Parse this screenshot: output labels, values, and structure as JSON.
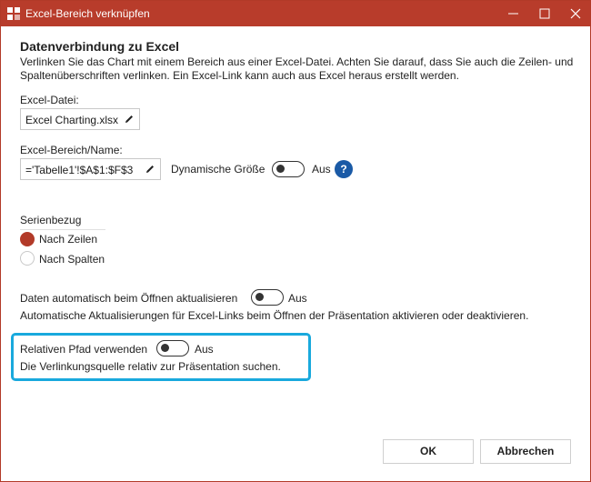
{
  "window": {
    "title": "Excel-Bereich verknüpfen",
    "accent_color": "#b83c2b",
    "controls": [
      "minimize-icon",
      "maximize-icon",
      "close-icon"
    ]
  },
  "section": {
    "heading": "Datenverbindung zu Excel",
    "description": "Verlinken Sie das Chart mit einem Bereich aus einer Excel-Datei. Achten Sie darauf, dass Sie auch die Zeilen- und Spaltenüberschriften verlinken. Ein Excel-Link kann auch aus Excel heraus erstellt werden."
  },
  "excel_file": {
    "label": "Excel-Datei:",
    "value": "Excel Charting.xlsx",
    "edit_icon": "pencil-icon"
  },
  "excel_range": {
    "label": "Excel-Bereich/Name:",
    "value": "='Tabelle1'!$A$1:$F$3",
    "edit_icon": "pencil-icon",
    "dynamic_size_label": "Dynamische Größe",
    "dynamic_size_state": "Aus",
    "help_label": "?",
    "help_color": "#1a5aa6"
  },
  "series": {
    "label": "Serienbezug",
    "options": [
      {
        "label": "Nach Zeilen",
        "selected": true
      },
      {
        "label": "Nach Spalten",
        "selected": false
      }
    ]
  },
  "auto_update": {
    "label": "Daten automatisch beim Öffnen aktualisieren",
    "state": "Aus",
    "description": "Automatische Aktualisierungen für Excel-Links beim Öffnen der Präsentation aktivieren oder deaktivieren."
  },
  "relative_path": {
    "label": "Relativen Pfad verwenden",
    "state": "Aus",
    "description": "Die Verlinkungsquelle relativ zur Präsentation suchen.",
    "highlight_color": "#19a9dd"
  },
  "buttons": {
    "ok": "OK",
    "cancel": "Abbrechen"
  }
}
